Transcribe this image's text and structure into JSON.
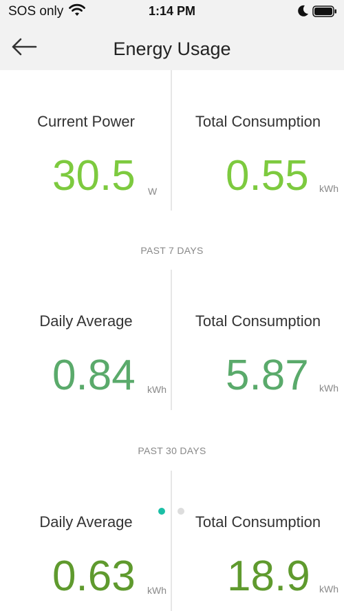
{
  "status_bar": {
    "carrier": "SOS only",
    "time": "1:14 PM",
    "icons": [
      "wifi-icon",
      "moon-icon",
      "battery-icon"
    ]
  },
  "nav": {
    "title": "Energy Usage",
    "back_icon": "back-arrow-icon"
  },
  "current": {
    "left": {
      "label": "Current Power",
      "value": "30.5",
      "unit": "W"
    },
    "right": {
      "label": "Total Consumption",
      "value": "0.55",
      "unit": "kWh"
    }
  },
  "past_7_days": {
    "header": "PAST 7 DAYS",
    "left": {
      "label": "Daily Average",
      "value": "0.84",
      "unit": "kWh"
    },
    "right": {
      "label": "Total Consumption",
      "value": "5.87",
      "unit": "kWh"
    }
  },
  "past_30_days": {
    "header": "PAST 30 DAYS",
    "left": {
      "label": "Daily Average",
      "value": "0.63",
      "unit": "kWh"
    },
    "right": {
      "label": "Total Consumption",
      "value": "18.9",
      "unit": "kWh"
    }
  },
  "pager": {
    "page_count": 2,
    "active_page": 1
  },
  "colors": {
    "current_green": "#7dca3f",
    "week_green": "#5aaa6b",
    "month_green": "#5f9a2e",
    "page_dot_active": "#1bbfa6",
    "page_dot_inactive": "#dddddd"
  }
}
